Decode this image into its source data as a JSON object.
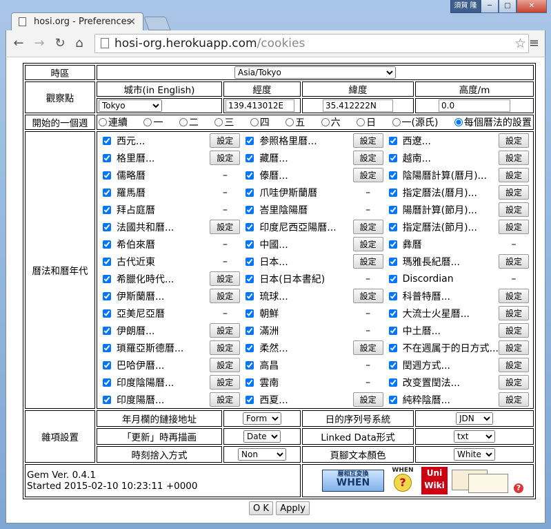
{
  "window": {
    "tab_title": "hosi.org - Preferences",
    "min_label": "─",
    "max_label": "□",
    "close_label": "✕",
    "user_badge": "須賀 隆"
  },
  "address": {
    "host": "hosi-org.herokuapp.com",
    "path": "/cookies"
  },
  "timezone": {
    "label": "時區",
    "value": "Asia/Tokyo"
  },
  "observer": {
    "label": "觀察點",
    "city_header": "城市(in English)",
    "lon_header": "經度",
    "lat_header": "緯度",
    "alt_header": "高度/m",
    "city": "Tokyo",
    "lon": "139.413012E",
    "lat": "35.412222N",
    "alt": "0.0"
  },
  "week": {
    "label": "開始的一個週",
    "options": [
      "連續",
      "一",
      "二",
      "三",
      "四",
      "五",
      "六",
      "日",
      "一(源氏)",
      "每個曆法的設置"
    ],
    "selected": 9
  },
  "calendars": {
    "label": "曆法和曆年代",
    "setting_label": "設定",
    "dash": "–",
    "col1": [
      [
        "西元...",
        1
      ],
      [
        "格里曆...",
        1
      ],
      [
        "儒略曆",
        0
      ],
      [
        "羅馬曆",
        0
      ],
      [
        "拜占庭曆",
        0
      ],
      [
        "法國共和曆...",
        1
      ],
      [
        "希伯來曆",
        0
      ],
      [
        "古代近東",
        0
      ],
      [
        "希臘化時代...",
        1
      ],
      [
        "伊斯蘭曆...",
        1
      ],
      [
        "亞美尼亞曆",
        0
      ],
      [
        "伊朗曆...",
        1
      ],
      [
        "瑣羅亞斯德曆...",
        1
      ],
      [
        "巴哈伊曆...",
        1
      ],
      [
        "印度陰陽曆...",
        1
      ],
      [
        "印度陽曆...",
        1
      ]
    ],
    "col2": [
      [
        "参照格里曆...",
        1
      ],
      [
        "藏曆...",
        1
      ],
      [
        "傣曆...",
        1
      ],
      [
        "爪哇伊斯蘭曆",
        0
      ],
      [
        "峇里陰陽曆",
        0
      ],
      [
        "印度尼西亞陽曆...",
        1
      ],
      [
        "中國...",
        1
      ],
      [
        "日本...",
        1
      ],
      [
        "日本(日本書紀)",
        0
      ],
      [
        "琉球...",
        1
      ],
      [
        "朝鮮",
        0
      ],
      [
        "滿洲",
        0
      ],
      [
        "柔然...",
        1
      ],
      [
        "高昌",
        0
      ],
      [
        "雲南",
        0
      ],
      [
        "西夏...",
        1
      ]
    ],
    "col3": [
      [
        "西遼...",
        1
      ],
      [
        "越南...",
        1
      ],
      [
        "陰陽曆計算(曆月)...",
        1
      ],
      [
        "指定曆法(曆月)...",
        1
      ],
      [
        "陽曆計算(節月)...",
        1
      ],
      [
        "指定曆法(節月)...",
        1
      ],
      [
        "彝曆",
        0
      ],
      [
        "瑪雅長紀曆...",
        1
      ],
      [
        "Discordian",
        0
      ],
      [
        "科普特曆...",
        1
      ],
      [
        "大流士火星曆...",
        1
      ],
      [
        "中土曆...",
        1
      ],
      [
        "不在週属于的日方式...",
        1
      ],
      [
        "閏週方式...",
        1
      ],
      [
        "改变置閏法...",
        1
      ],
      [
        "純粋陰曆...",
        1
      ]
    ]
  },
  "misc": {
    "label": "雜項設置",
    "rows": [
      {
        "l1": "年月欄的鏈接地址",
        "v1": "Form",
        "l2": "日的序列号系統",
        "v2": "JDN"
      },
      {
        "l1": "「更新」時再描画",
        "v1": "Date",
        "l2": "Linked Data形式",
        "v2": "txt"
      },
      {
        "l1": "時刻捨入方式",
        "v1": "Non",
        "l2": "頁腳文本顏色",
        "v2": "White"
      }
    ]
  },
  "footer": {
    "version": "Gem Ver. 0.4.1",
    "started": "Started 2015-02-10 10:23:11 +0000",
    "badge_when_top": "暦相互変換",
    "badge_when": "WHEN",
    "badge_when2": "WHEN",
    "badge_uni": "Uni",
    "badge_wiki": "Wiki",
    "help": "?"
  },
  "buttons": {
    "ok": "O K",
    "apply": "Apply"
  },
  "colors": {
    "frame": "#8fb4dc",
    "help": "#d33"
  }
}
